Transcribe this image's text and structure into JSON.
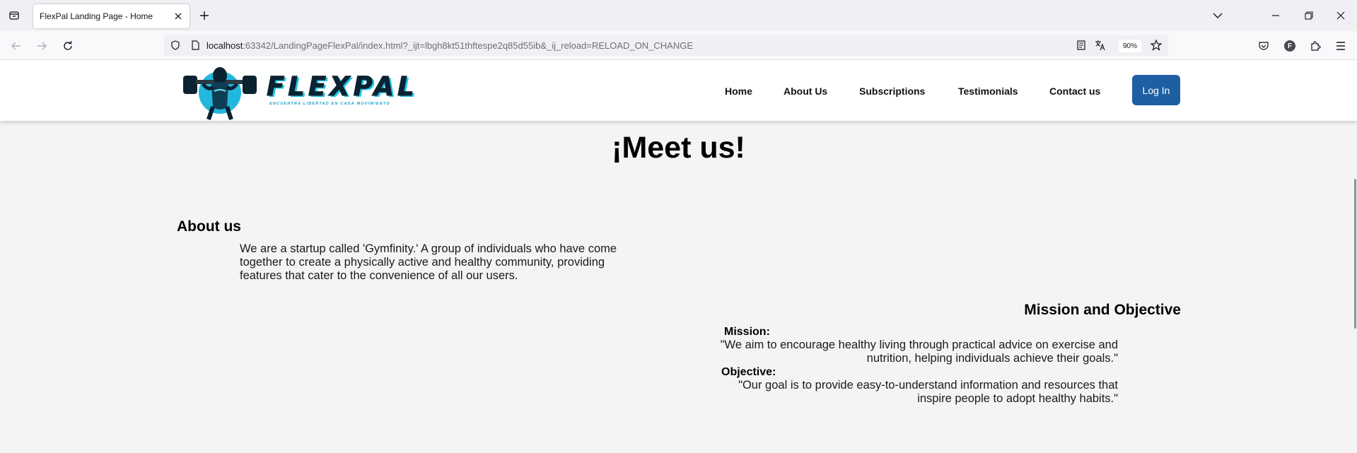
{
  "browser": {
    "tab_title": "FlexPal Landing Page - Home",
    "url_host": "localhost",
    "url_rest": ":63342/LandingPageFlexPal/index.html?_ijt=lbgh8kt51thftespe2q85d55ib&_ij_reload=RELOAD_ON_CHANGE",
    "zoom": "90%",
    "profile_initial": "F"
  },
  "site": {
    "logo_word": "FLEXPAL",
    "logo_tagline": "ENCUENTRA LIBERTAD EN CADA MOVIMIENTO",
    "nav": {
      "home": "Home",
      "about": "About Us",
      "subscriptions": "Subscriptions",
      "testimonials": "Testimonials",
      "contact": "Contact us"
    },
    "login_label": "Log In"
  },
  "content": {
    "title": "¡Meet us!",
    "about_heading": "About us",
    "about_text": "We are a startup called 'Gymfinity.' A group of individuals who have come together to create a physically active and healthy community, providing features that cater to the convenience of all our users.",
    "mission_heading": "Mission and Objective",
    "mission_label": "Mission:",
    "mission_text": "\"We aim to encourage healthy living through practical advice on exercise and nutrition, helping individuals achieve their goals.\"",
    "objective_label": "Objective:",
    "objective_text": "\"Our goal is to provide easy-to-understand information and resources that inspire people to adopt healthy habits.\""
  },
  "colors": {
    "accent_blue": "#1e5fa3",
    "logo_cyan": "#22c4e6",
    "page_background": "#f4f4f4"
  }
}
